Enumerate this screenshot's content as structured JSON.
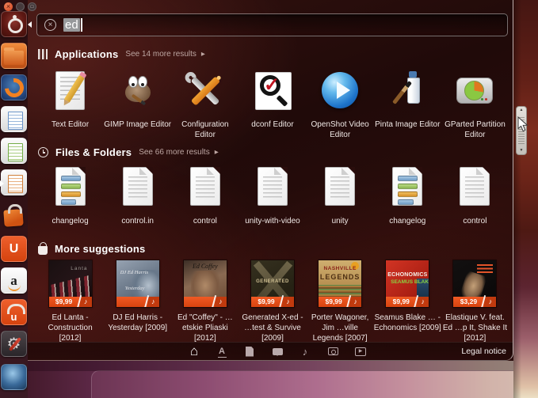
{
  "glyphs": {
    "close": "×",
    "maximize": "□",
    "clear": "×",
    "caret_right": "▸",
    "caret_down": "▾",
    "up": "▲",
    "down": "▼",
    "home": "⌂",
    "apps_lens": "A",
    "music": "♪",
    "play": "▶",
    "note": "♪",
    "gear": "⚙",
    "check": "✓"
  },
  "search": {
    "value": "ed"
  },
  "launcher": {
    "items": [
      {
        "id": "ubuntu-dash"
      },
      {
        "id": "files"
      },
      {
        "id": "firefox"
      },
      {
        "id": "libreoffice-writer"
      },
      {
        "id": "libreoffice-calc"
      },
      {
        "id": "libreoffice-impress"
      },
      {
        "id": "ubuntu-software-center"
      },
      {
        "id": "ubuntu-one",
        "letter": "U"
      },
      {
        "id": "amazon",
        "letter": "a"
      },
      {
        "id": "ubuntu-one-music",
        "letter": "u"
      },
      {
        "id": "system-settings"
      },
      {
        "id": "web-app"
      }
    ]
  },
  "applications": {
    "title": "Applications",
    "more_results": "See 14 more results",
    "items": [
      {
        "label": "Text Editor"
      },
      {
        "label": "GIMP Image Editor"
      },
      {
        "label": "Configuration Editor"
      },
      {
        "label": "dconf Editor"
      },
      {
        "label": "OpenShot Video Editor"
      },
      {
        "label": "Pinta Image Editor"
      },
      {
        "label": "GParted Partition Editor"
      }
    ]
  },
  "files": {
    "title": "Files & Folders",
    "more_results": "See 66 more results",
    "items": [
      {
        "label": "changelog"
      },
      {
        "label": "control.in"
      },
      {
        "label": "control"
      },
      {
        "label": "unity-with-video"
      },
      {
        "label": "unity"
      },
      {
        "label": "changelog"
      },
      {
        "label": "control"
      }
    ]
  },
  "suggestions": {
    "title": "More suggestions",
    "items": [
      {
        "label": "Ed Lanta - Construction [2012]",
        "price": "$9,99",
        "cover": {
          "line1": "Lanta",
          "line2": ""
        }
      },
      {
        "label": "DJ Ed Harris - Yesterday [2009]",
        "price": "",
        "cover": {
          "line1": "DJ Ed Harris",
          "line2": "Yesterday"
        }
      },
      {
        "label": "Ed \"Coffey\" - …etskie Pliaski [2012]",
        "price": "",
        "cover": {
          "line1": "Ed Coffey",
          "line2": ""
        }
      },
      {
        "label": "Generated X-ed - …test & Survive [2009]",
        "price": "$9,99",
        "cover": {
          "line1": "GENERATED",
          "line2": ""
        }
      },
      {
        "label": "Porter Wagoner, Jim …ville Legends [2007]",
        "price": "$9,99",
        "cover": {
          "line1": "NASHVILLE",
          "line2": "LEGENDS"
        }
      },
      {
        "label": "Seamus Blake … - Echonomics [2009]",
        "price": "$9,99",
        "cover": {
          "line1": "ECHONOMICS",
          "line2": "SEAMUS BLAKE"
        }
      },
      {
        "label": "Elastique V. feat. Ed …p It, Shake It [2012]",
        "price": "$3,29",
        "cover": {
          "line1": "",
          "line2": ""
        }
      }
    ]
  },
  "lens_bar": {
    "legal_notice": "Legal notice"
  }
}
